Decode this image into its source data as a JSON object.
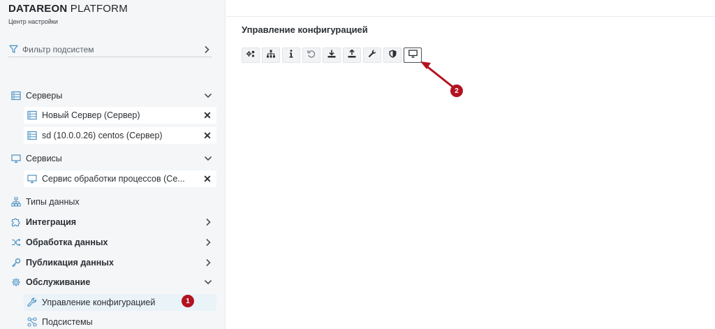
{
  "brand": {
    "bold": "DATAREON",
    "light": " PLATFORM",
    "subtitle": "Центр настройки"
  },
  "filter": {
    "label": "Фильтр подсистем"
  },
  "sidebar": {
    "servers": {
      "label": "Серверы",
      "items": [
        {
          "label": "Новый Сервер (Сервер)"
        },
        {
          "label": "sd (10.0.0.26) centos (Сервер)"
        }
      ]
    },
    "services": {
      "label": "Сервисы",
      "items": [
        {
          "label": "Сервис обработки процессов (Се..."
        }
      ]
    },
    "data_types": {
      "label": "Типы данных"
    },
    "integration": {
      "label": "Интеграция"
    },
    "data_processing": {
      "label": "Обработка данных"
    },
    "data_publishing": {
      "label": "Публикация данных"
    },
    "maintenance": {
      "label": "Обслуживание",
      "items": [
        {
          "label": "Управление конфигурацией",
          "badge": "1"
        },
        {
          "label": "Подсистемы"
        }
      ]
    }
  },
  "main": {
    "title": "Управление конфигурацией",
    "toolbar_icons": [
      "gears-icon",
      "hierarchy-icon",
      "info-icon",
      "undo-icon",
      "download-icon",
      "upload-icon",
      "wrench-icon",
      "shield-icon",
      "monitor-icon"
    ],
    "annotation_badge": "2"
  },
  "colors": {
    "accent": "#4a90c2",
    "badge": "#b3121f",
    "sidebar_bg": "#f4f6f8"
  }
}
